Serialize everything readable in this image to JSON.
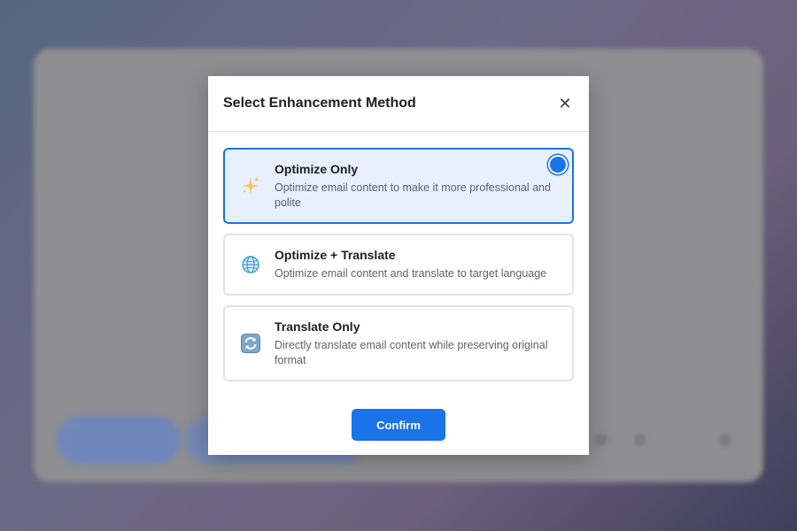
{
  "dialog": {
    "title": "Select Enhancement Method",
    "close_icon": "close-icon",
    "confirm_label": "Confirm",
    "selected_option": "optimize-only"
  },
  "options": [
    {
      "id": "optimize-only",
      "icon": "sparkles-icon",
      "title": "Optimize Only",
      "description": "Optimize email content to make it more professional and polite",
      "selected": true
    },
    {
      "id": "optimize-translate",
      "icon": "globe-icon",
      "title": "Optimize + Translate",
      "description": "Optimize email content and translate to target language",
      "selected": false
    },
    {
      "id": "translate-only",
      "icon": "refresh-icon",
      "title": "Translate Only",
      "description": "Directly translate email content while preserving original format",
      "selected": false
    }
  ],
  "colors": {
    "accent": "#1a73e8",
    "selected_bg": "#e8f0fd",
    "border": "#e1e3e6"
  }
}
